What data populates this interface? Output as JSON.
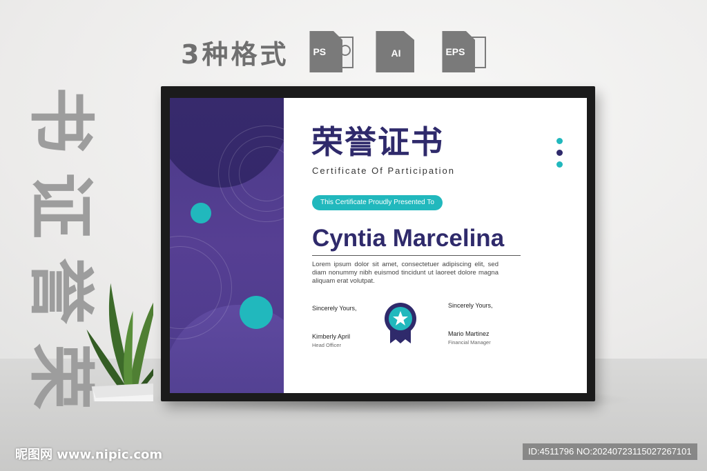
{
  "header": {
    "formats_title": "3种格式",
    "formats": [
      {
        "label": "PS",
        "icon": "photoshop-file-icon"
      },
      {
        "label": "AI",
        "icon": "illustrator-file-icon"
      },
      {
        "label": "EPS",
        "icon": "eps-file-icon"
      }
    ]
  },
  "side_text": [
    "书",
    "证",
    "誉",
    "荣"
  ],
  "certificate": {
    "title": "荣誉证书",
    "subtitle": "Certificate Of Participation",
    "presented_label": "This Certificate Proudly Presented To",
    "recipient": "Cyntia Marcelina",
    "body": "Lorem ipsum dolor sit amet, consectetuer adipiscing elit, sed diam nonummy nibh euismod tincidunt ut laoreet dolore magna aliquam erat volutpat.",
    "left_signature": {
      "closing": "Sincerely Yours,",
      "name": "Kimberly April",
      "role": "Head Officer"
    },
    "right_signature": {
      "closing": "Sincerely Yours,",
      "name": "Mario Martinez",
      "role": "Financial Manager"
    }
  },
  "colors": {
    "purple_dark": "#2f2a6b",
    "purple": "#4a3a87",
    "teal": "#21b8bd"
  },
  "watermarks": {
    "left": "昵图网 www.nipic.com",
    "right": "ID:4511796 NO:20240723115027267101"
  }
}
